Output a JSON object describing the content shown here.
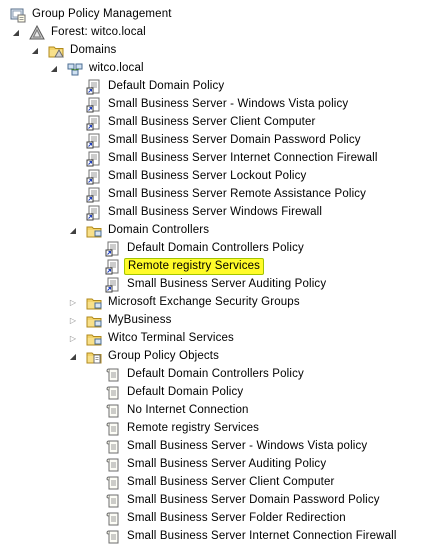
{
  "theme": {
    "selection_fill": "#fffb2a",
    "selection_border": "#a4c400"
  },
  "tree": [
    {
      "label": "Group Policy Management",
      "level": 0,
      "icon": "gpm-console-icon",
      "expander": "none"
    },
    {
      "label": "Forest: witco.local",
      "level": 1,
      "icon": "forest-icon",
      "expander": "expanded"
    },
    {
      "label": "Domains",
      "level": 2,
      "icon": "domains-folder-icon",
      "expander": "expanded"
    },
    {
      "label": "witco.local",
      "level": 3,
      "icon": "domain-icon",
      "expander": "expanded"
    },
    {
      "label": "Default Domain Policy",
      "level": 4,
      "icon": "gpo-link-icon",
      "expander": "none"
    },
    {
      "label": "Small Business Server - Windows Vista policy",
      "level": 4,
      "icon": "gpo-link-icon",
      "expander": "none"
    },
    {
      "label": "Small Business Server Client Computer",
      "level": 4,
      "icon": "gpo-link-icon",
      "expander": "none"
    },
    {
      "label": "Small Business Server Domain Password Policy",
      "level": 4,
      "icon": "gpo-link-icon",
      "expander": "none"
    },
    {
      "label": "Small Business Server Internet Connection Firewall",
      "level": 4,
      "icon": "gpo-link-icon",
      "expander": "none"
    },
    {
      "label": "Small Business Server Lockout Policy",
      "level": 4,
      "icon": "gpo-link-icon",
      "expander": "none"
    },
    {
      "label": "Small Business Server Remote Assistance Policy",
      "level": 4,
      "icon": "gpo-link-icon",
      "expander": "none"
    },
    {
      "label": "Small Business Server Windows Firewall",
      "level": 4,
      "icon": "gpo-link-icon",
      "expander": "none"
    },
    {
      "label": "Domain Controllers",
      "level": 4,
      "icon": "ou-folder-icon",
      "expander": "expanded"
    },
    {
      "label": "Default Domain Controllers Policy",
      "level": 5,
      "icon": "gpo-link-icon",
      "expander": "none"
    },
    {
      "label": "Remote registry Services",
      "level": 5,
      "icon": "gpo-link-icon",
      "expander": "none",
      "selected": true
    },
    {
      "label": "Small Business Server Auditing Policy",
      "level": 5,
      "icon": "gpo-link-icon",
      "expander": "none"
    },
    {
      "label": "Microsoft Exchange Security Groups",
      "level": 4,
      "icon": "ou-folder-icon",
      "expander": "collapsed"
    },
    {
      "label": "MyBusiness",
      "level": 4,
      "icon": "ou-folder-icon",
      "expander": "collapsed"
    },
    {
      "label": "Witco Terminal Services",
      "level": 4,
      "icon": "ou-folder-icon",
      "expander": "collapsed"
    },
    {
      "label": "Group Policy Objects",
      "level": 4,
      "icon": "gpo-container-icon",
      "expander": "expanded"
    },
    {
      "label": "Default Domain Controllers Policy",
      "level": 5,
      "icon": "gpo-icon",
      "expander": "none"
    },
    {
      "label": "Default Domain Policy",
      "level": 5,
      "icon": "gpo-icon",
      "expander": "none"
    },
    {
      "label": "No Internet Connection",
      "level": 5,
      "icon": "gpo-icon",
      "expander": "none"
    },
    {
      "label": "Remote registry Services",
      "level": 5,
      "icon": "gpo-icon",
      "expander": "none"
    },
    {
      "label": "Small Business Server - Windows Vista policy",
      "level": 5,
      "icon": "gpo-icon",
      "expander": "none"
    },
    {
      "label": "Small Business Server Auditing Policy",
      "level": 5,
      "icon": "gpo-icon",
      "expander": "none"
    },
    {
      "label": "Small Business Server Client Computer",
      "level": 5,
      "icon": "gpo-icon",
      "expander": "none"
    },
    {
      "label": "Small Business Server Domain Password Policy",
      "level": 5,
      "icon": "gpo-icon",
      "expander": "none"
    },
    {
      "label": "Small Business Server Folder Redirection",
      "level": 5,
      "icon": "gpo-icon",
      "expander": "none"
    },
    {
      "label": "Small Business Server Internet Connection Firewall",
      "level": 5,
      "icon": "gpo-icon",
      "expander": "none"
    }
  ]
}
